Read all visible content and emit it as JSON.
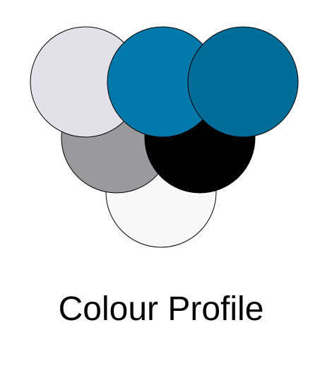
{
  "title": "Colour Profile",
  "swatches": [
    {
      "name": "light-grey",
      "color": "#e2e1e8"
    },
    {
      "name": "mid-grey",
      "color": "#9a9a9d"
    },
    {
      "name": "white",
      "color": "#f8f8f8"
    },
    {
      "name": "black",
      "color": "#000000"
    },
    {
      "name": "blue",
      "color": "#0079aa"
    },
    {
      "name": "dark-blue",
      "color": "#006d99"
    }
  ],
  "outline_color": "#000000"
}
